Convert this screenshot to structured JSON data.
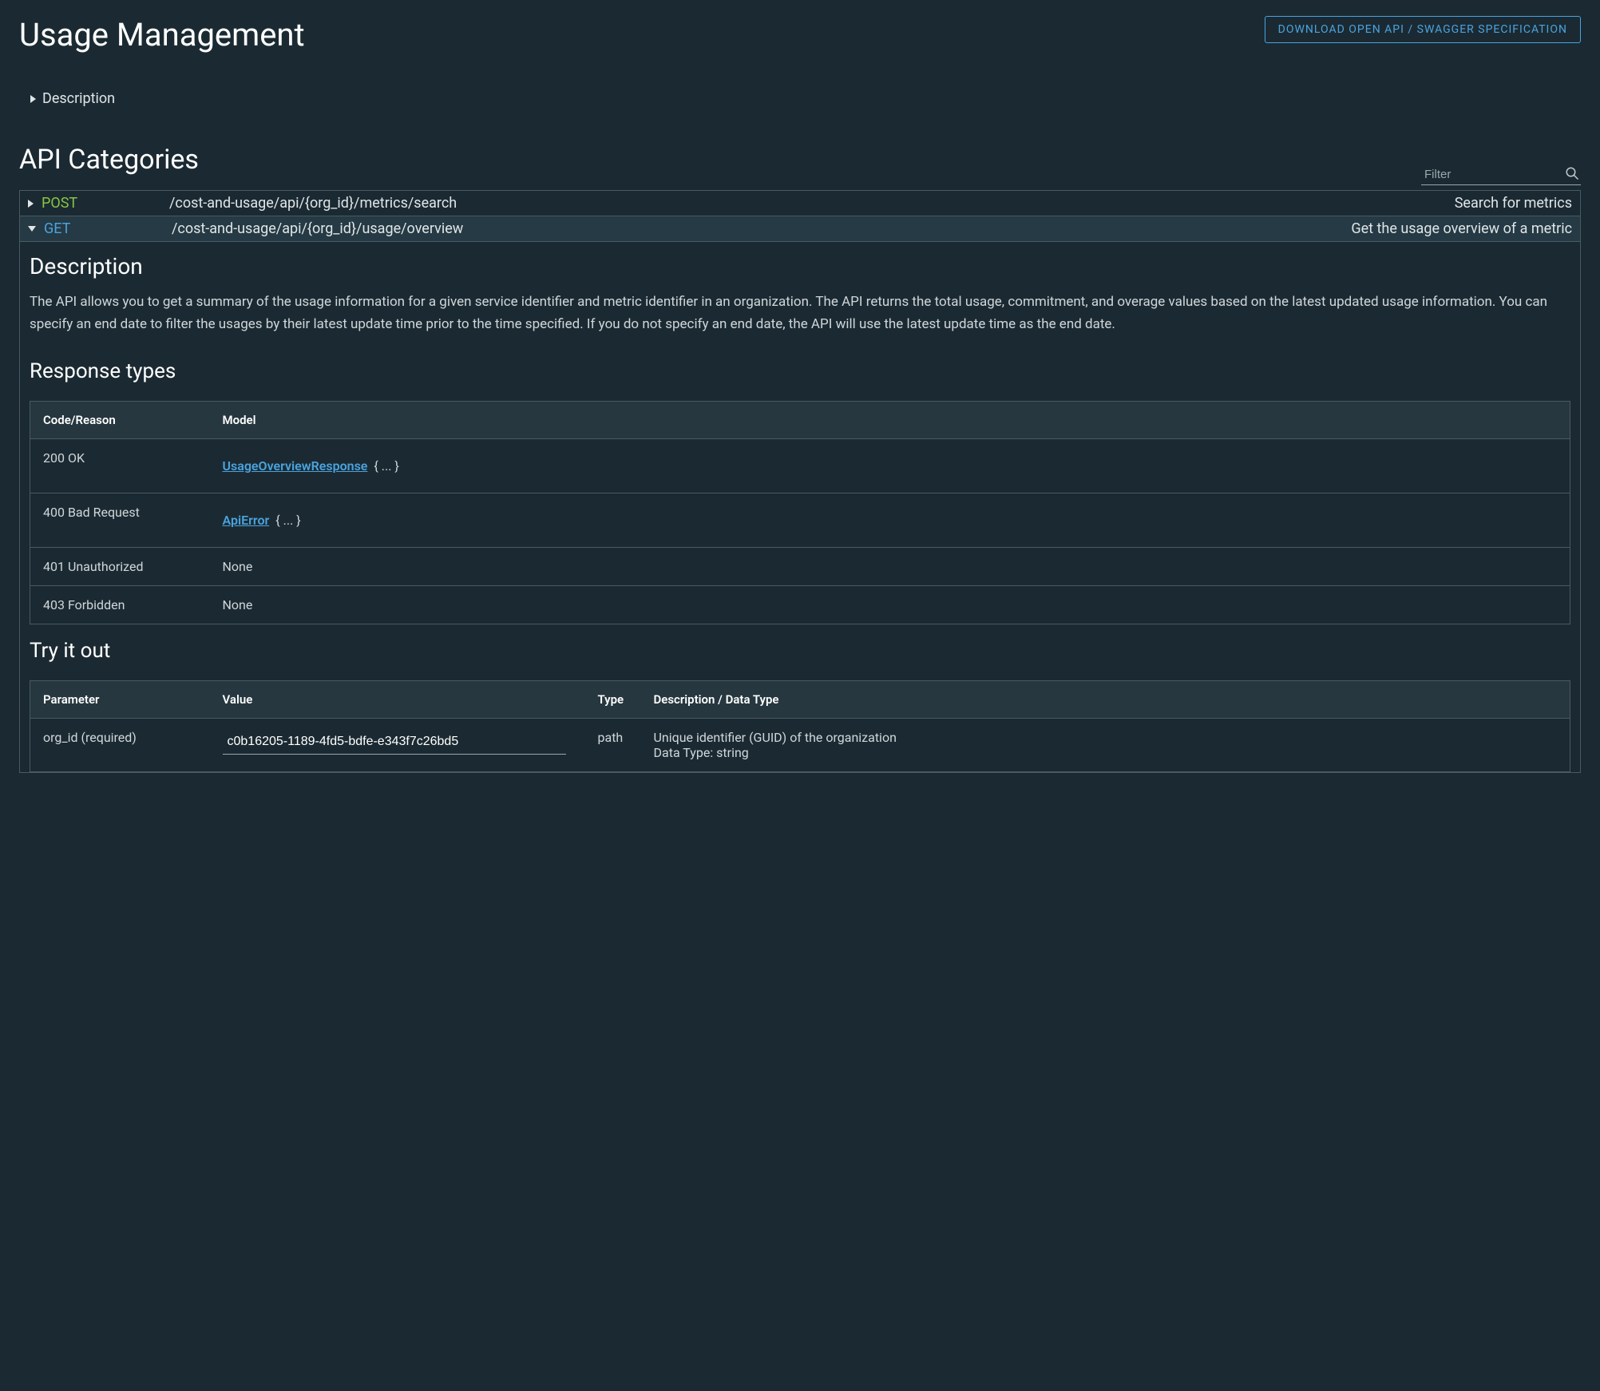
{
  "header": {
    "title": "Usage Management",
    "download_label": "DOWNLOAD OPEN API / SWAGGER SPECIFICATION"
  },
  "description_toggle": {
    "label": "Description"
  },
  "categories": {
    "title": "API Categories",
    "filter_placeholder": "Filter"
  },
  "endpoints": [
    {
      "method": "POST",
      "path": "/cost-and-usage/api/{org_id}/metrics/search",
      "summary": "Search for metrics",
      "expanded": false
    },
    {
      "method": "GET",
      "path": "/cost-and-usage/api/{org_id}/usage/overview",
      "summary": "Get the usage overview of a metric",
      "expanded": true
    }
  ],
  "detail": {
    "description_heading": "Description",
    "description_text": "The API allows you to get a summary of the usage information for a given service identifier and metric identifier in an organization. The API returns the total usage, commitment, and overage values based on the latest updated usage information. You can specify an end date to filter the usages by their latest update time prior to the time specified. If you do not specify an end date, the API will use the latest update time as the end date.",
    "response_types_heading": "Response types",
    "response_headers": {
      "code": "Code/Reason",
      "model": "Model"
    },
    "responses": [
      {
        "code": "200 OK",
        "model": "UsageOverviewResponse",
        "braces": "{ ... }"
      },
      {
        "code": "400 Bad Request",
        "model": "ApiError",
        "braces": "{ ... }"
      },
      {
        "code": "401 Unauthorized",
        "model": null,
        "none_text": "None"
      },
      {
        "code": "403 Forbidden",
        "model": null,
        "none_text": "None"
      }
    ],
    "try_heading": "Try it out",
    "try_headers": {
      "parameter": "Parameter",
      "value": "Value",
      "type": "Type",
      "desc": "Description / Data Type"
    },
    "try_params": [
      {
        "name": "org_id (required)",
        "value": "c0b16205-1189-4fd5-bdfe-e343f7c26bd5",
        "type": "path",
        "desc_line1": "Unique identifier (GUID) of the organization",
        "desc_line2": "Data Type: string"
      }
    ]
  }
}
